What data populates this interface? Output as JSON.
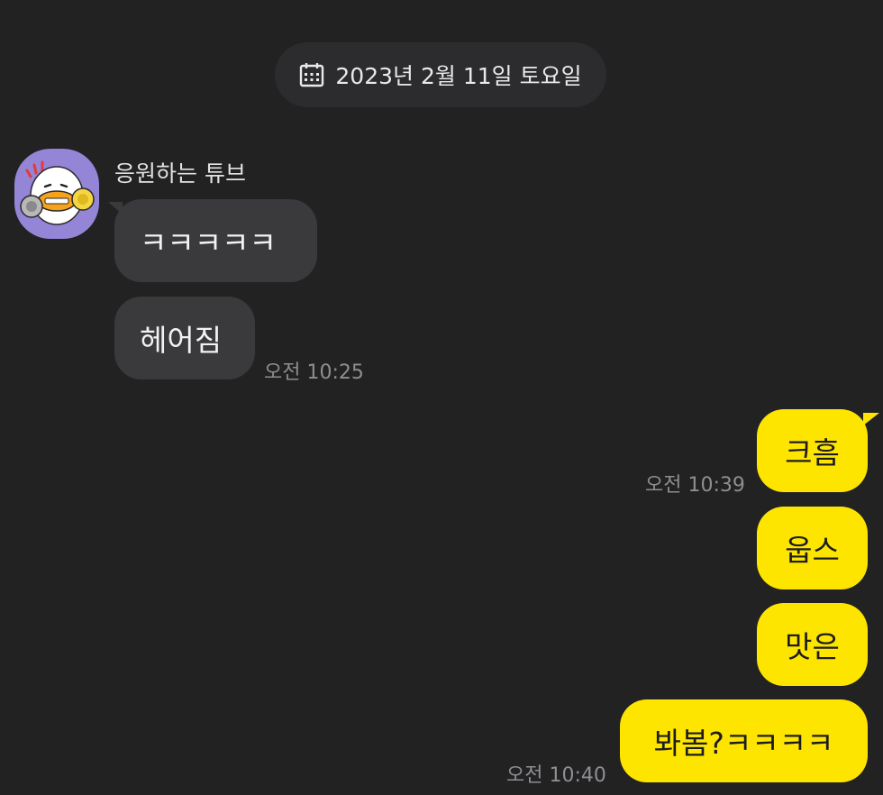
{
  "date_separator": {
    "icon": "calendar-icon",
    "label": "2023년 2월 11일 토요일"
  },
  "sender": {
    "name": "응원하는 튜브",
    "avatar_icon": "tube-cheering-avatar",
    "avatar_bg": "#9485d6"
  },
  "incoming": [
    {
      "text": "ㅋㅋㅋㅋㅋ",
      "time": ""
    },
    {
      "text": "헤어짐",
      "time": "오전 10:25"
    }
  ],
  "outgoing": [
    {
      "text": "크흠",
      "time": "오전 10:39"
    },
    {
      "text": "웁스",
      "time": ""
    },
    {
      "text": "맛은",
      "time": ""
    },
    {
      "text": "봐봄?ㅋㅋㅋㅋ",
      "time": "오전 10:40"
    }
  ],
  "colors": {
    "background": "#222223",
    "incoming_bubble": "#3a3a3c",
    "outgoing_bubble": "#fde500"
  }
}
